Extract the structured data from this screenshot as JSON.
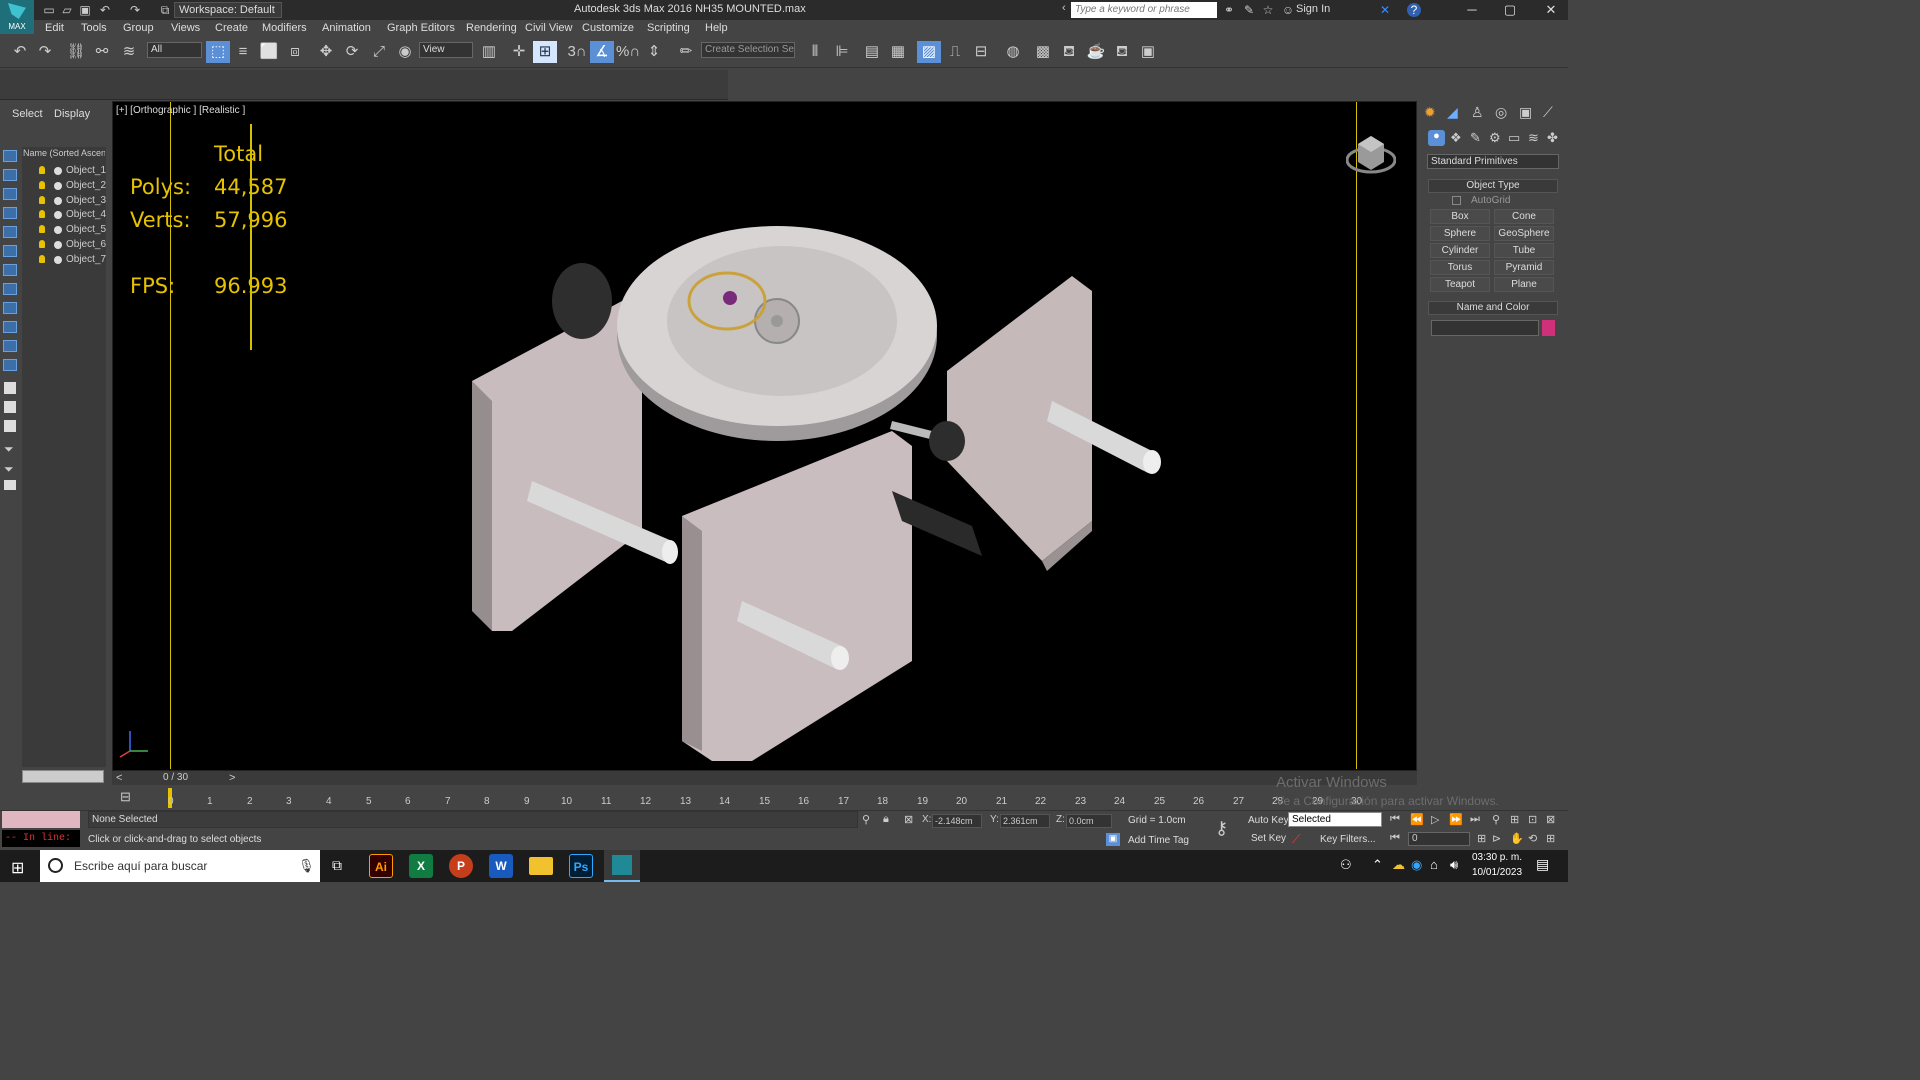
{
  "app": {
    "logo_text": "MAX",
    "title": "Autodesk 3ds Max 2016    NH35 MOUNTED.max",
    "workspace": "Workspace: Default",
    "search_placeholder": "Type a keyword or phrase",
    "sign_in": "Sign In"
  },
  "menu": [
    "Edit",
    "Tools",
    "Group",
    "Views",
    "Create",
    "Modifiers",
    "Animation",
    "Graph Editors",
    "Rendering",
    "Civil View",
    "Customize",
    "Scripting",
    "Help"
  ],
  "toolbar": {
    "filter_value": "All",
    "ref_coord_value": "View",
    "selection_set_placeholder": "Create Selection Se",
    "snap_labels": [
      "3",
      "%"
    ]
  },
  "scene_explorer": {
    "tabs": [
      "Select",
      "Display"
    ],
    "column_header": "Name (Sorted Ascen",
    "objects": [
      "Object_1",
      "Object_2",
      "Object_3",
      "Object_4",
      "Object_5",
      "Object_6",
      "Object_7"
    ]
  },
  "viewport": {
    "label": "[+] [Orthographic ] [Realistic ]",
    "stats": {
      "header": "Total",
      "polys_label": "Polys:",
      "polys_value": "44,587",
      "verts_label": "Verts:",
      "verts_value": "57,996",
      "fps_label": "FPS:",
      "fps_value": "96.993"
    }
  },
  "command_panel": {
    "category": "Standard Primitives",
    "object_type_title": "Object Type",
    "autogrid_label": "AutoGrid",
    "buttons": [
      "Box",
      "Cone",
      "Sphere",
      "GeoSphere",
      "Cylinder",
      "Tube",
      "Torus",
      "Pyramid",
      "Teapot",
      "Plane"
    ],
    "name_color_title": "Name and Color",
    "color_swatch": "#d0307a"
  },
  "timeline": {
    "frame_indicator": "0 / 30",
    "ticks": [
      "0",
      "1",
      "2",
      "3",
      "4",
      "5",
      "6",
      "7",
      "8",
      "9",
      "10",
      "11",
      "12",
      "13",
      "14",
      "15",
      "16",
      "17",
      "18",
      "19",
      "20",
      "21",
      "22",
      "23",
      "24",
      "25",
      "26",
      "27",
      "28",
      "29",
      "30"
    ]
  },
  "status": {
    "maxscript_inline": "-- In line:",
    "selection": "None Selected",
    "prompt": "Click or click-and-drag to select objects",
    "x_label": "X:",
    "x_value": "-2.148cm",
    "y_label": "Y:",
    "y_value": "2.361cm",
    "z_label": "Z:",
    "z_value": "0.0cm",
    "grid": "Grid = 1.0cm",
    "add_time_tag": "Add Time Tag",
    "auto_key": "Auto Key",
    "set_key": "Set Key",
    "selected_dropdown": "Selected",
    "key_filters": "Key Filters...",
    "frame_field": "0"
  },
  "watermark": {
    "line1": "Activar Windows",
    "line2": "Ve a Configuración para activar Windows."
  },
  "taskbar": {
    "search_placeholder": "Escribe aquí para buscar",
    "time": "03:30 p. m.",
    "date": "10/01/2023",
    "apps": [
      "Ai",
      "X",
      "P",
      "W",
      "Ps"
    ]
  }
}
